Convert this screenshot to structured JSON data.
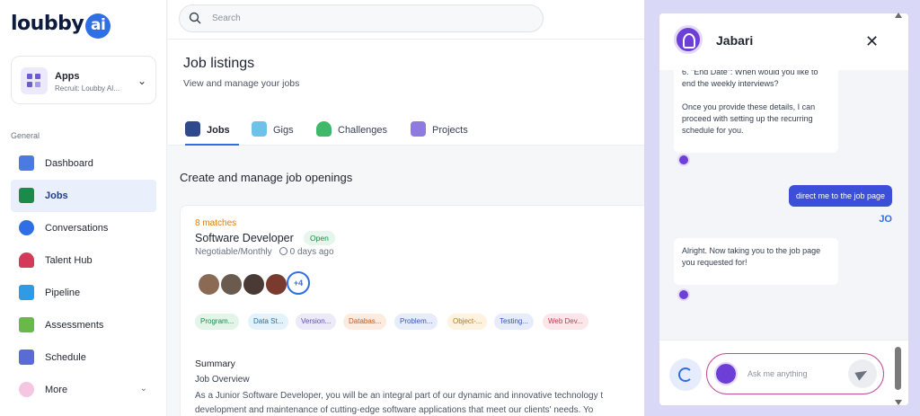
{
  "brand": {
    "logo_text": "loubby",
    "logo_ai": "ai"
  },
  "app_switcher": {
    "title": "Apps",
    "subtitle": "Recruit: Loubby AI..."
  },
  "sidebar": {
    "section_label": "General",
    "items": [
      {
        "label": "Dashboard",
        "icon": "dashboard-icon",
        "color": "#4a7be0"
      },
      {
        "label": "Jobs",
        "icon": "briefcase-icon",
        "color": "#1a8b4a"
      },
      {
        "label": "Conversations",
        "icon": "chat-icon",
        "color": "#2f6fe4"
      },
      {
        "label": "Talent Hub",
        "icon": "person-icon",
        "color": "#d33a5a"
      },
      {
        "label": "Pipeline",
        "icon": "pipeline-icon",
        "color": "#2f9be4"
      },
      {
        "label": "Assessments",
        "icon": "clipboard-icon",
        "color": "#6bb84a"
      },
      {
        "label": "Schedule",
        "icon": "calendar-icon",
        "color": "#5b6bd6"
      },
      {
        "label": "More",
        "icon": "more-icon",
        "color": "#d65ba8"
      }
    ]
  },
  "search": {
    "placeholder": "Search"
  },
  "page": {
    "title": "Job listings",
    "subtitle": "View and manage your jobs",
    "tabs": [
      {
        "label": "Jobs",
        "icon": "briefcase-icon",
        "color": "#2e4a8c"
      },
      {
        "label": "Gigs",
        "icon": "gig-icon",
        "color": "#6ec2ea"
      },
      {
        "label": "Challenges",
        "icon": "trophy-icon",
        "color": "#3fb86a"
      },
      {
        "label": "Projects",
        "icon": "cube-icon",
        "color": "#8f7be0"
      }
    ],
    "section_title": "Create and manage job openings"
  },
  "job": {
    "matches": "8 matches",
    "title": "Software Developer",
    "status": "Open",
    "pay": "Negotiable/Monthly",
    "posted": "0 days ago",
    "extra_avatars": "+4",
    "skills": [
      {
        "label": "Program...",
        "bg": "#e3f5e8",
        "fg": "#1a8b4a"
      },
      {
        "label": "Data St...",
        "bg": "#e3f2fb",
        "fg": "#1f6fa8"
      },
      {
        "label": "Version...",
        "bg": "#eceaf8",
        "fg": "#5b4fb8"
      },
      {
        "label": "Databas...",
        "bg": "#fdebe0",
        "fg": "#c4571a"
      },
      {
        "label": "Problem...",
        "bg": "#e6ecfb",
        "fg": "#3b55b8"
      },
      {
        "label": "Object-...",
        "bg": "#fff2df",
        "fg": "#b57a12"
      },
      {
        "label": "Testing...",
        "bg": "#e6ecfb",
        "fg": "#2f55c4"
      },
      {
        "label": "Web Dev...",
        "bg": "#fde6ea",
        "fg": "#c0394f"
      }
    ],
    "summary_label": "Summary",
    "overview_label": "Job Overview",
    "description_lines": [
      "As a Junior Software Developer, you will be an integral part of our dynamic and innovative technology t",
      "development and maintenance of cutting-edge software applications that meet our clients' needs. Yo"
    ]
  },
  "chat": {
    "agent_name": "Jabari",
    "messages": [
      {
        "from": "bot",
        "text": "6. \"End Date\": When would you like to end the weekly interviews?\n\nOnce you provide these details, I can proceed with setting up the recurring schedule for you."
      },
      {
        "from": "user",
        "text": "direct me to the job page",
        "tag": "JO"
      },
      {
        "from": "bot",
        "text": "Alright. Now taking you to the job page you requested for!"
      }
    ],
    "input_placeholder": "Ask me anything"
  }
}
